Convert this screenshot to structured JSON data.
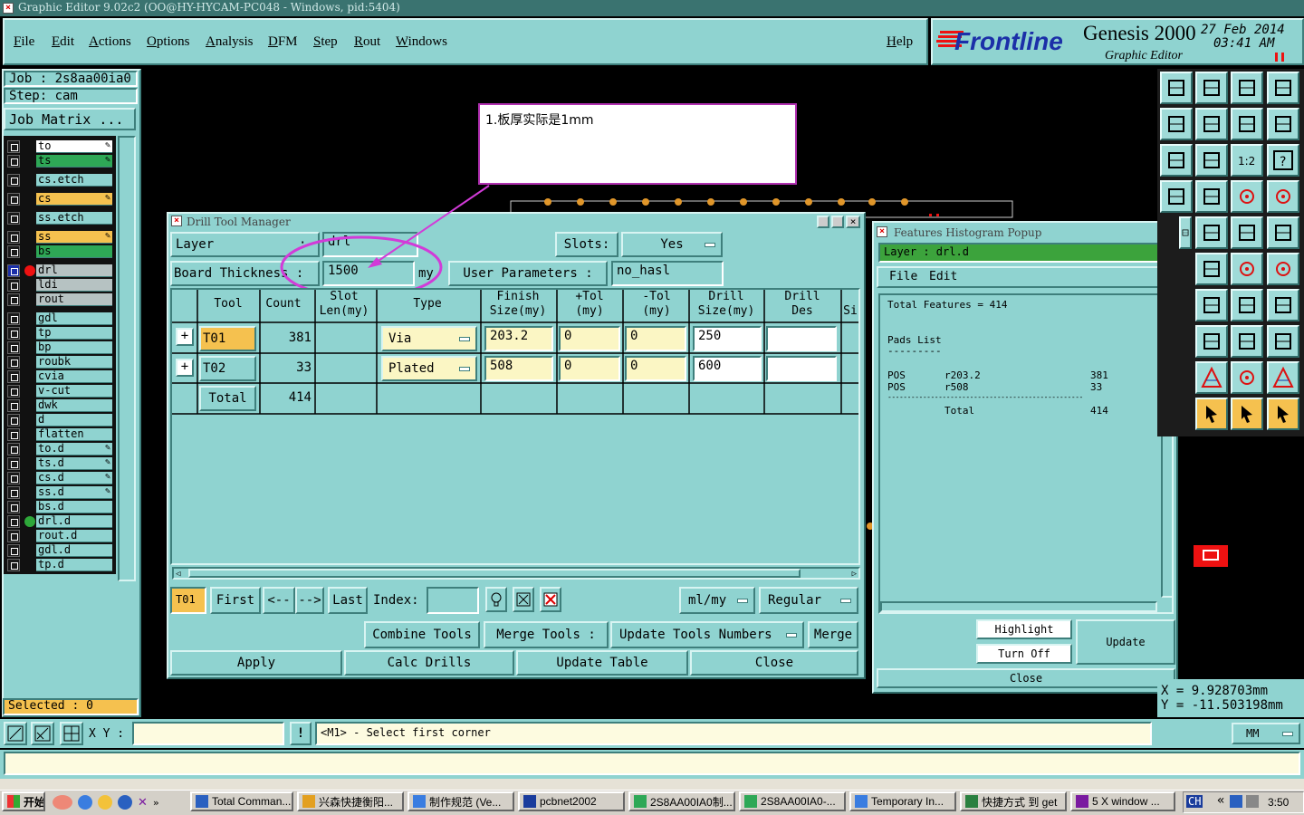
{
  "window": {
    "title": "Graphic Editor 9.02c2 (OO@HY-HYCAM-PC048 - Windows, pid:5404)"
  },
  "menu": [
    "File",
    "Edit",
    "Actions",
    "Options",
    "Analysis",
    "DFM",
    "Step",
    "Rout",
    "Windows"
  ],
  "help": "Help",
  "brand": {
    "logo": "Frontline",
    "product": "Genesis 2000",
    "subtitle": "Graphic Editor",
    "date": "27 Feb 2014",
    "time": "03:41 AM"
  },
  "job": {
    "job_label": "Job : 2s8aa00ia0",
    "step_label": "Step: cam",
    "matrix_button": "Job Matrix ..."
  },
  "layers": [
    {
      "name": "to",
      "style": "white",
      "edit": true
    },
    {
      "name": "ts",
      "style": "green",
      "edit": true
    },
    {
      "name": "cs.etch",
      "style": "teal",
      "edit": false
    },
    {
      "name": "cs",
      "style": "orange",
      "edit": true
    },
    {
      "name": "ss.etch",
      "style": "teal",
      "edit": false
    },
    {
      "name": "ss",
      "style": "orange",
      "edit": true
    },
    {
      "name": "bs",
      "style": "green",
      "edit": false
    },
    {
      "name": "drl",
      "style": "grey",
      "edit": false,
      "active": true
    },
    {
      "name": "ldi",
      "style": "grey",
      "edit": false
    },
    {
      "name": "rout",
      "style": "grey",
      "edit": false
    },
    {
      "name": "gdl",
      "style": "teal",
      "edit": false
    },
    {
      "name": "tp",
      "style": "teal",
      "edit": false
    },
    {
      "name": "bp",
      "style": "teal",
      "edit": false
    },
    {
      "name": "roubk",
      "style": "teal",
      "edit": false
    },
    {
      "name": "cvia",
      "style": "teal",
      "edit": false
    },
    {
      "name": "v-cut",
      "style": "teal",
      "edit": false
    },
    {
      "name": "dwk",
      "style": "teal",
      "edit": false
    },
    {
      "name": "d",
      "style": "teal",
      "edit": false
    },
    {
      "name": "flatten",
      "style": "teal",
      "edit": false
    },
    {
      "name": "to.d",
      "style": "teal",
      "edit": true
    },
    {
      "name": "ts.d",
      "style": "teal",
      "edit": true
    },
    {
      "name": "cs.d",
      "style": "teal",
      "edit": true
    },
    {
      "name": "ss.d",
      "style": "teal",
      "edit": true
    },
    {
      "name": "bs.d",
      "style": "teal",
      "edit": false
    },
    {
      "name": "drl.d",
      "style": "teal",
      "edit": false,
      "marked": true
    },
    {
      "name": "rout.d",
      "style": "teal",
      "edit": false
    },
    {
      "name": "gdl.d",
      "style": "teal",
      "edit": false
    },
    {
      "name": "tp.d",
      "style": "teal",
      "edit": false
    }
  ],
  "selected": "Selected : 0",
  "annotation": "1.板厚实际是1mm",
  "drill": {
    "title": "Drill Tool Manager",
    "layer_label": "Layer",
    "layer_value": "drl",
    "slots_label": "Slots:",
    "slots_value": "Yes",
    "thickness_label": "Board Thickness :",
    "thickness_value": "1500",
    "thickness_unit": "my",
    "user_params_label": "User Parameters :",
    "user_params_value": "no_hasl",
    "headers": {
      "tool": "Tool",
      "count": "Count",
      "slot1": "Slot",
      "slot2": "Len(my)",
      "type": "Type",
      "finish1": "Finish",
      "finish2": "Size(my)",
      "ptol1": "+Tol",
      "ptol2": "(my)",
      "mtol1": "-Tol",
      "mtol2": "(my)",
      "drill1": "Drill",
      "drill2": "Size(my)",
      "des1": "Drill",
      "des2": "Des",
      "si": "Si"
    },
    "rows": [
      {
        "tool": "T01",
        "count": "381",
        "type": "Via",
        "finish": "203.2",
        "ptol": "0",
        "mtol": "0",
        "drill": "250",
        "des": ""
      },
      {
        "tool": "T02",
        "count": "33",
        "type": "Plated",
        "finish": "508",
        "ptol": "0",
        "mtol": "0",
        "drill": "600",
        "des": ""
      }
    ],
    "total_label": "Total",
    "total_count": "414",
    "nav": {
      "current": "T01",
      "first": "First",
      "prev": "<--",
      "next": "-->",
      "last": "Last",
      "index": "Index:",
      "unit": "ml/my",
      "mode": "Regular"
    },
    "actions": {
      "combine": "Combine Tools",
      "merge_label": "Merge Tools :",
      "update_numbers": "Update Tools Numbers",
      "merge": "Merge"
    },
    "bottom": {
      "apply": "Apply",
      "calc": "Calc Drills",
      "update": "Update Table",
      "close": "Close"
    }
  },
  "histogram": {
    "title": "Features Histogram Popup",
    "layer_label": "Layer :  drl.d",
    "file": "File",
    "edit": "Edit",
    "total_features": "Total Features = 414",
    "pads_title": "Pads List",
    "pads_rule": "---------",
    "rows": [
      {
        "kind": "POS",
        "sym": "r203.2",
        "count": "381"
      },
      {
        "kind": "POS",
        "sym": "r508",
        "count": "33"
      }
    ],
    "divider": "--------------------------------------------------",
    "total_label": "Total",
    "total_value": "414",
    "highlight": "Highlight",
    "turn_off": "Turn Off",
    "update": "Update",
    "close": "Close"
  },
  "coords": {
    "x": "X = 9.928703mm",
    "y": "Y = -11.503198mm",
    "unit": "MM"
  },
  "status": {
    "xy_label": "X Y :",
    "message": "<M1> - Select first corner"
  },
  "taskbar": {
    "start": "开始",
    "items": [
      "Total Comman...",
      "兴森快捷衡阳...",
      "制作规范 (Ve...",
      "pcbnet2002",
      "2S8AA00IA0制...",
      "2S8AA00IA0-...",
      "Temporary In...",
      "快捷方式 到 get",
      "5 X window ..."
    ],
    "lang": "CH",
    "clock": "3:50"
  }
}
